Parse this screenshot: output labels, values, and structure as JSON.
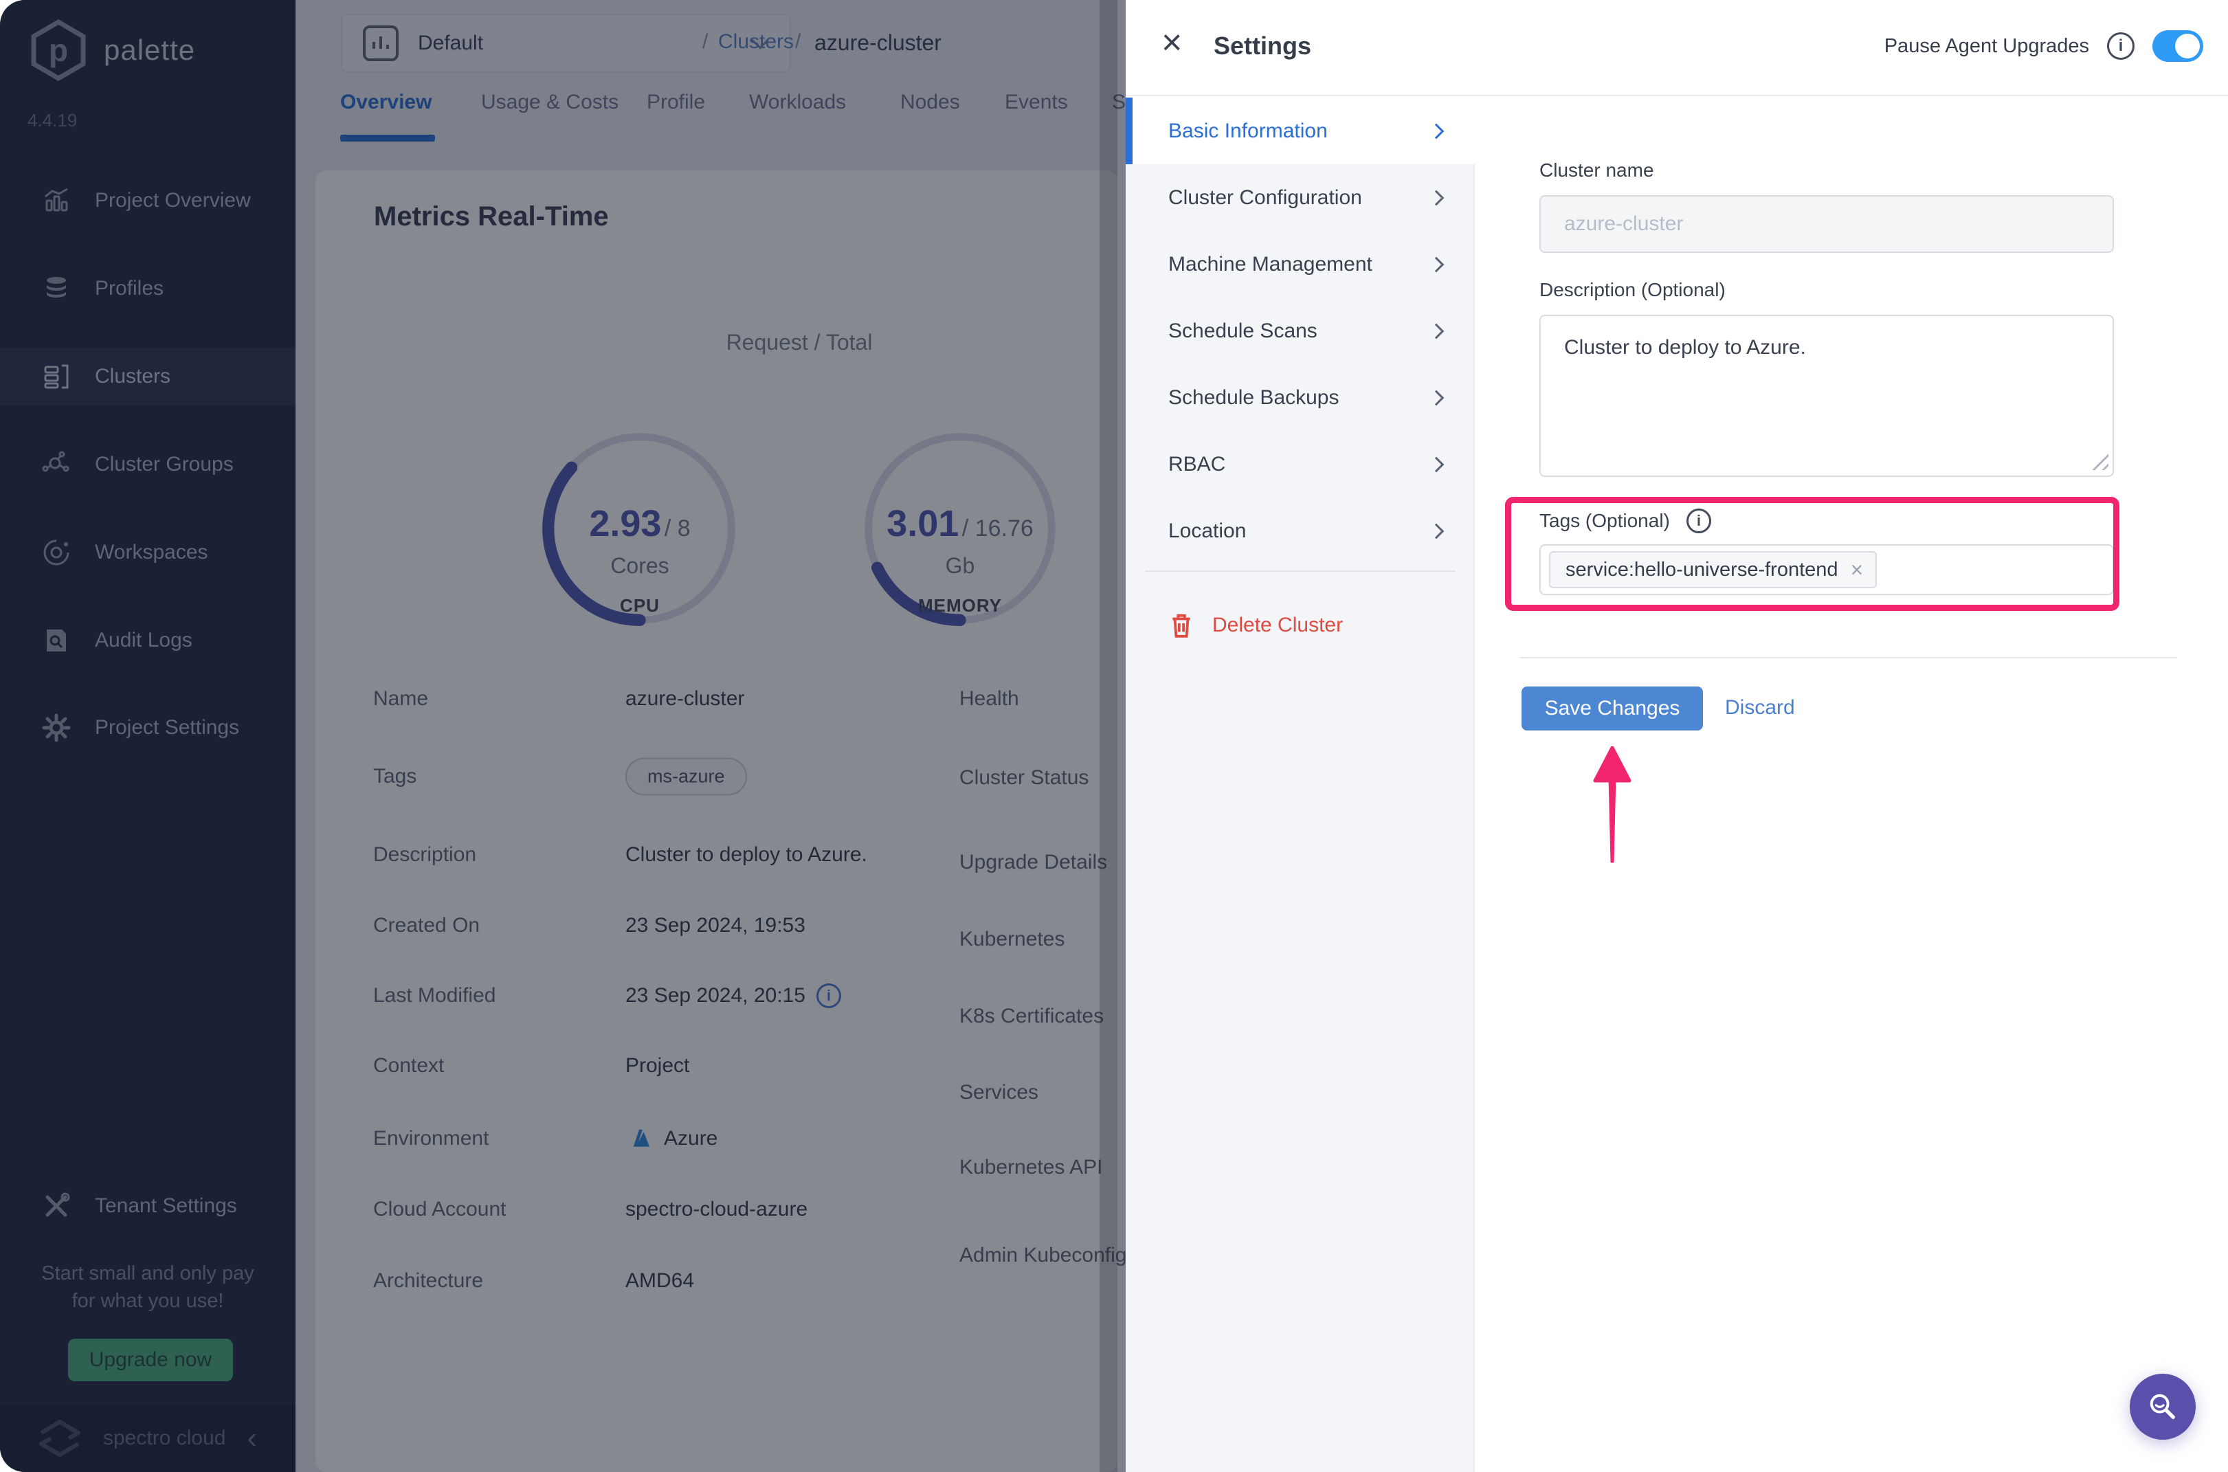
{
  "sidebar": {
    "logo_text": "palette",
    "version": "4.4.19",
    "items": [
      {
        "label": "Project Overview",
        "icon": "chart-icon"
      },
      {
        "label": "Profiles",
        "icon": "database-icon"
      },
      {
        "label": "Clusters",
        "icon": "clusters-icon",
        "active": true
      },
      {
        "label": "Cluster Groups",
        "icon": "network-icon"
      },
      {
        "label": "Workspaces",
        "icon": "orbit-icon"
      },
      {
        "label": "Audit Logs",
        "icon": "audit-doc-icon"
      },
      {
        "label": "Project Settings",
        "icon": "gear-icon"
      }
    ],
    "tenant_settings_label": "Tenant Settings",
    "promo_line1": "Start small and only pay",
    "promo_line2": "for what you use!",
    "upgrade_button": "Upgrade now",
    "brand_name": "spectro cloud",
    "collapse_icon": "‹"
  },
  "main": {
    "project_selector": {
      "label": "Default",
      "icon": "bar-chart-icon"
    },
    "breadcrumb": {
      "sep1": "/",
      "clusters_link": "Clusters",
      "sep2": "/",
      "current": "azure-cluster"
    },
    "tabs": [
      {
        "label": "Overview",
        "active": true
      },
      {
        "label": "Usage & Costs"
      },
      {
        "label": "Profile"
      },
      {
        "label": "Workloads"
      },
      {
        "label": "Nodes"
      },
      {
        "label": "Events"
      },
      {
        "label": "S"
      }
    ],
    "metrics": {
      "title": "Metrics Real-Time",
      "legend": "Request / Total",
      "gauges": [
        {
          "value": "2.93",
          "total": "/ 8",
          "unit": "Cores",
          "caption": "CPU",
          "fraction": 0.366
        },
        {
          "value": "3.01",
          "total": "/ 16.76",
          "unit": "Gb",
          "caption": "MEMORY",
          "fraction": 0.18
        }
      ]
    },
    "details": {
      "left_rows": [
        {
          "label": "Name",
          "value": "azure-cluster"
        },
        {
          "label": "Tags",
          "value": "ms-azure"
        },
        {
          "label": "Description",
          "value": "Cluster to deploy to Azure."
        },
        {
          "label": "Created On",
          "value": "23 Sep 2024, 19:53"
        },
        {
          "label": "Last Modified",
          "value": "23 Sep 2024, 20:15"
        },
        {
          "label": "Context",
          "value": "Project"
        },
        {
          "label": "Environment",
          "value": "Azure"
        },
        {
          "label": "Cloud Account",
          "value": "spectro-cloud-azure"
        },
        {
          "label": "Architecture",
          "value": "AMD64"
        }
      ],
      "right_labels": [
        "Health",
        "Cluster Status",
        "Upgrade Details",
        "Kubernetes",
        "K8s Certificates",
        "Services",
        "Kubernetes API",
        "Admin Kubeconfig File"
      ]
    }
  },
  "settings_panel": {
    "title": "Settings",
    "close_icon": "×",
    "pause_agent_upgrades_label": "Pause Agent Upgrades",
    "toggle_state": "on",
    "nav": [
      {
        "label": "Basic Information",
        "active": true
      },
      {
        "label": "Cluster Configuration"
      },
      {
        "label": "Machine Management"
      },
      {
        "label": "Schedule Scans"
      },
      {
        "label": "Schedule Backups"
      },
      {
        "label": "RBAC"
      },
      {
        "label": "Location"
      }
    ],
    "delete_cluster_label": "Delete Cluster",
    "form": {
      "cluster_name_label": "Cluster name",
      "cluster_name_value": "azure-cluster",
      "description_label": "Description (Optional)",
      "description_value": "Cluster to deploy to Azure.",
      "tags_label": "Tags (Optional)",
      "tag_chip": "service:hello-universe-frontend",
      "chip_remove_icon": "×",
      "save_button": "Save Changes",
      "discard_link": "Discard"
    }
  },
  "fab": {
    "icon": "search-magnifier"
  },
  "colors": {
    "highlight_pink": "#F1256D",
    "toggle_blue": "#2E9BF6",
    "save_blue": "#4D87D3",
    "active_blue": "#2A6FD4",
    "delete_red": "#DF4B41",
    "fab_purple": "#5A50AC",
    "upgrade_green": "#4CAF82",
    "gauge_indigo": "#4F58B2",
    "sidebar_bg": "#262F49"
  }
}
